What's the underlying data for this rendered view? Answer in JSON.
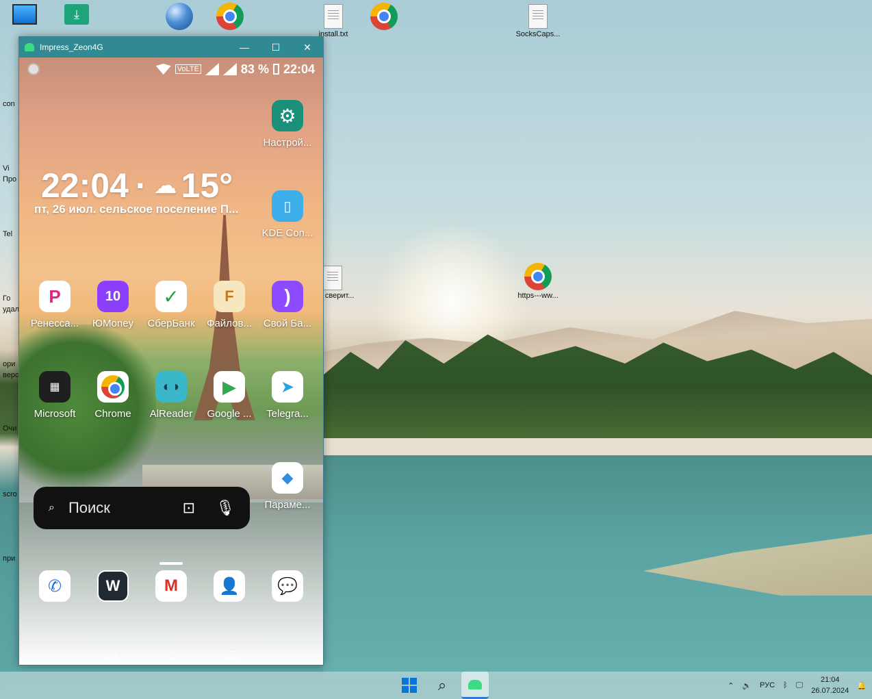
{
  "window": {
    "title": "Impress_Zeon4G",
    "minimize": "—",
    "maximize": "☐",
    "close": "✕"
  },
  "status_bar": {
    "volte": "VoLTE",
    "battery_percent": "83 %",
    "time": "22:04"
  },
  "widget": {
    "time": "22:04",
    "separator": "·",
    "temperature": "15°",
    "date_location": "пт, 26 июл.  сельское поселение П..."
  },
  "apps_right": [
    {
      "name": "Настрой...",
      "icon": "settings-icon",
      "color": "#1a8f7a"
    },
    {
      "name": "KDE Con...",
      "icon": "kde-connect-icon",
      "color": "#3daee9"
    },
    {
      "name": "Параме...",
      "icon": "parameters-icon",
      "color": "#ffffff"
    }
  ],
  "apps_row1": [
    {
      "name": "Ренесса...",
      "icon": "renaissance-icon",
      "color": "#ffffff"
    },
    {
      "name": "ЮMoney",
      "icon": "yumoney-icon",
      "color": "#8b3ffc"
    },
    {
      "name": "СберБанк",
      "icon": "sberbank-icon",
      "color": "#ffffff"
    },
    {
      "name": "Файлов...",
      "icon": "files-icon",
      "color": "#f6e7c1"
    },
    {
      "name": "Свой Ба...",
      "icon": "svoy-bank-icon",
      "color": "#8c4bff"
    }
  ],
  "apps_row2": [
    {
      "name": "Microsoft",
      "icon": "microsoft-icon",
      "color": "#1f1f1f"
    },
    {
      "name": "Chrome",
      "icon": "chrome-icon",
      "color": "#ffffff"
    },
    {
      "name": "AlReader",
      "icon": "alreader-icon",
      "color": "#3ab7c8"
    },
    {
      "name": "Google ...",
      "icon": "google-play-icon",
      "color": "#ffffff"
    },
    {
      "name": "Telegra...",
      "icon": "telegram-icon",
      "color": "#ffffff"
    }
  ],
  "dock": [
    {
      "icon": "phone-icon",
      "color": "#ffffff"
    },
    {
      "icon": "wire-icon",
      "color": "#1f2a33"
    },
    {
      "icon": "gmail-go-icon",
      "color": "#ffffff"
    },
    {
      "icon": "contacts-icon",
      "color": "#ffffff"
    },
    {
      "icon": "messages-icon",
      "color": "#ffffff"
    }
  ],
  "search": {
    "placeholder": "Поиск"
  },
  "desktop_icons": [
    {
      "label": "install.txt"
    },
    {
      "label": "SocksCaps..."
    },
    {
      "label": "Как сверит..."
    },
    {
      "label": "https---ww..."
    }
  ],
  "left_strip_labels": [
    "con",
    "Vi",
    "Про",
    "Tel",
    "Го",
    "удал",
    "ори",
    "веро",
    "Очи",
    "scro",
    "при"
  ],
  "tray": {
    "language": "РУС",
    "time": "21:04",
    "date": "26.07.2024"
  }
}
